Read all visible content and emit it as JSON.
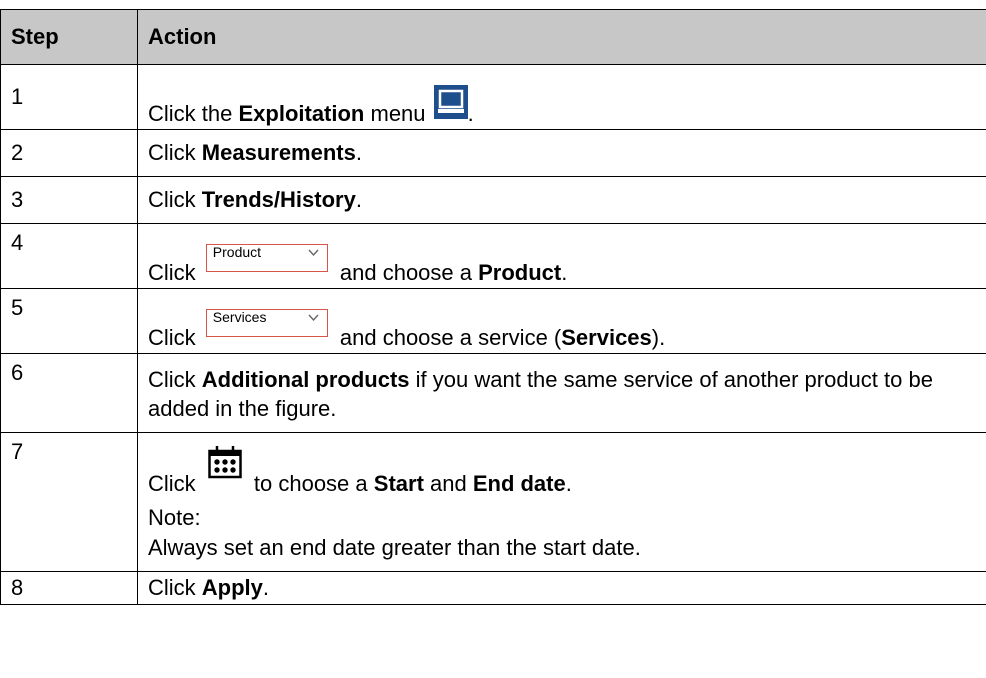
{
  "table": {
    "headers": {
      "step": "Step",
      "action": "Action"
    },
    "rows": [
      {
        "step": "1",
        "pre": "Click the ",
        "bold": "Exploitation",
        "post": " menu ",
        "icon": "monitor-icon",
        "tail": "."
      },
      {
        "step": "2",
        "pre": "Click ",
        "bold": "Measurements",
        "post": "."
      },
      {
        "step": "3",
        "pre": "Click ",
        "bold": "Trends/History",
        "post": "."
      },
      {
        "step": "4",
        "pre": "Click ",
        "dropdown": "Product",
        "mid": " and choose a ",
        "bold": "Product",
        "post": "."
      },
      {
        "step": "5",
        "pre": "Click ",
        "dropdown": "Services",
        "mid": " and choose a service (",
        "bold": "Services",
        "post": ")."
      },
      {
        "step": "6",
        "pre": "Click ",
        "bold": "Additional products",
        "post": " if you want the same service of another product to be added in the figure."
      },
      {
        "step": "7",
        "pre": "Click ",
        "icon": "calendar-icon",
        "mid": " to choose a ",
        "bold": "Start",
        "mid2": " and ",
        "bold2": "End date",
        "post": ".",
        "note_label": "Note:",
        "note_text": "Always set an end date greater than the start date."
      },
      {
        "step": "8",
        "pre": "Click ",
        "bold": "Apply",
        "post": "."
      }
    ]
  },
  "colors": {
    "header_bg": "#c7c7c7",
    "dropdown_border": "#d9554a",
    "icon_blue": "#1f4e8c"
  }
}
